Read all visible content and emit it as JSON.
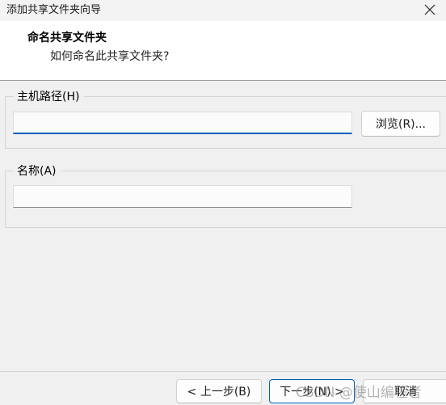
{
  "window": {
    "title": "添加共享文件夹向导",
    "close_icon": "close-icon"
  },
  "header": {
    "title": "命名共享文件夹",
    "subtitle": "如何命名此共享文件夹?"
  },
  "host_path": {
    "label": "主机路径(H)",
    "value": "",
    "browse_label": "浏览(R)..."
  },
  "name": {
    "label": "名称(A)",
    "value": ""
  },
  "footer": {
    "back_label": "< 上一步(B)",
    "next_label": "下一步(N) >",
    "cancel_label": "取消"
  },
  "watermark": "CSDN @使山编程者",
  "colors": {
    "accent": "#005fb8",
    "background": "#f0f0f0",
    "header_bg": "#ffffff"
  }
}
